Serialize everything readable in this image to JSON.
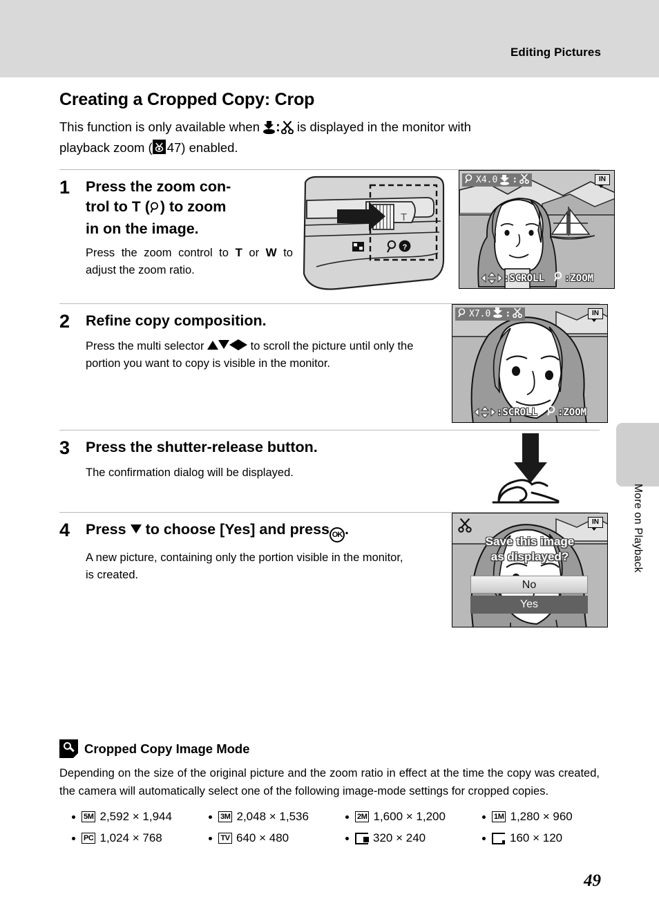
{
  "header": {
    "title": "Editing Pictures"
  },
  "page": {
    "title": "Creating a Cropped Copy: Crop",
    "intro_part1": "This  function  is  only  available  when",
    "intro_part2": "is  displayed  in  the  monitor  with",
    "intro_part3": "playback zoom (",
    "intro_ref": "47",
    "intro_part4": ") enabled.",
    "number": "49"
  },
  "side_tab": {
    "label": "More on Playback"
  },
  "steps": [
    {
      "number": "1",
      "heading_a": "Press  the  zoom  con-",
      "heading_b": "trol to",
      "heading_t": "T",
      "heading_c": "(",
      "heading_d": ") to zoom",
      "heading_e": "in on the image.",
      "sub_a": "Press the zoom control to",
      "sub_t": "T",
      "sub_b": "or",
      "sub_w": "W",
      "sub_c": "to  adjust  the  zoom",
      "sub_d": "ratio."
    },
    {
      "number": "2",
      "heading": "Refine copy composition.",
      "sub_a": "Press the multi selector",
      "sub_b": "to scroll the picture until only the portion you want to copy is visible in the monitor."
    },
    {
      "number": "3",
      "heading": "Press the shutter-release button.",
      "sub": "The confirmation dialog will be displayed."
    },
    {
      "number": "4",
      "heading_a": "Press",
      "heading_b": "to choose [Yes] and press",
      "heading_c": ".",
      "sub": "A new picture, containing only the portion visible in the monitor, is created."
    }
  ],
  "lcd_screens": [
    {
      "zoom_label": "X4.0",
      "memory_badge": "IN",
      "scroll_label": ":SCROLL",
      "zoom_hint_label": ":ZOOM"
    },
    {
      "zoom_label": "X7.0",
      "memory_badge": "IN",
      "scroll_label": ":SCROLL",
      "zoom_hint_label": ":ZOOM"
    }
  ],
  "confirm_dialog": {
    "memory_badge": "IN",
    "message_line1": "Save this image",
    "message_line2": "as displayed?",
    "option_no": "No",
    "option_yes": "Yes"
  },
  "camera_figure": {
    "zoom_tele_label": "T"
  },
  "note": {
    "title": "Cropped Copy Image Mode",
    "body": "Depending on the size of the original picture and the zoom ratio in effect at the time the copy was created, the camera will automatically select one of the following image-mode settings for cropped copies.",
    "modes_row1": [
      {
        "badge": "5M",
        "size": "2,592 × 1,944"
      },
      {
        "badge": "3M",
        "size": "2,048 × 1,536"
      },
      {
        "badge": "2M",
        "size": "1,600 × 1,200"
      },
      {
        "badge": "1M",
        "size": "1,280 × 960"
      }
    ],
    "modes_row2": [
      {
        "badge": "PC",
        "size": "1,024 × 768"
      },
      {
        "badge": "TV",
        "size": "640 × 480"
      },
      {
        "badge": "",
        "size": "320 × 240"
      },
      {
        "badge": "",
        "size": "160 × 120"
      }
    ]
  },
  "colors": {
    "header_band": "#d9d9d9",
    "side_tab": "#cfcfcf",
    "lcd_bg": "#bdbdbd",
    "osd_bar": "#777777"
  }
}
